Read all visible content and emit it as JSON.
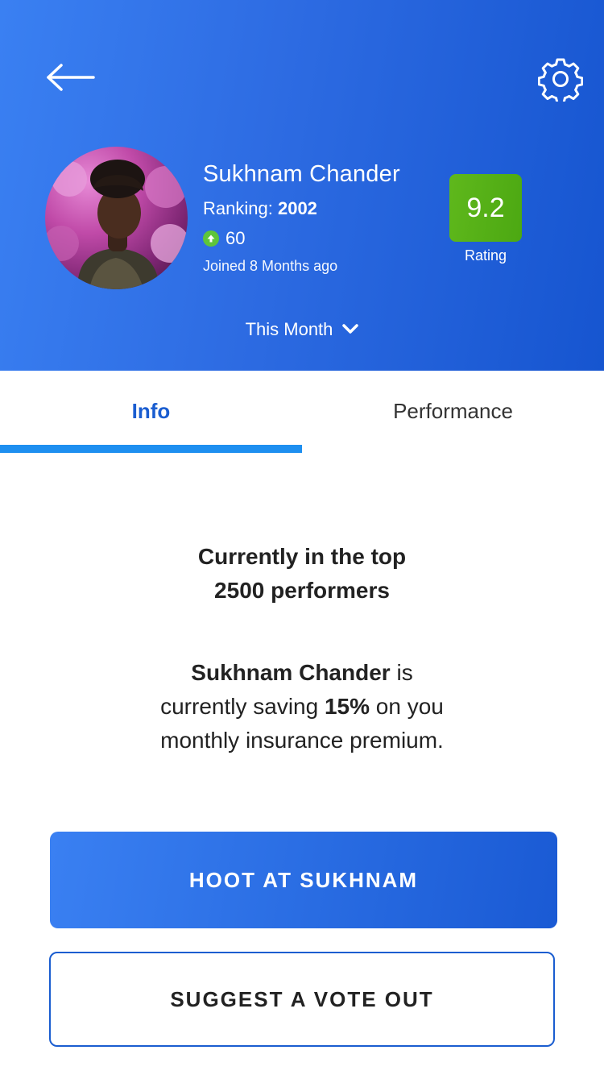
{
  "header": {
    "back_icon": "arrow-left-icon",
    "settings_icon": "gear-icon",
    "profile": {
      "name": "Sukhnam Chander",
      "ranking_label": "Ranking:",
      "ranking_value": "2002",
      "points": "60",
      "points_icon": "arrow-up-circle-icon",
      "joined": "Joined 8 Months ago"
    },
    "rating": {
      "value": "9.2",
      "label": "Rating"
    },
    "period": {
      "label": "This Month",
      "icon": "chevron-down-icon"
    }
  },
  "tabs": [
    {
      "label": "Info",
      "active": true
    },
    {
      "label": "Performance",
      "active": false
    }
  ],
  "info": {
    "top_line1": "Currently in the top",
    "top_line2": "2500 performers",
    "saving_name": "Sukhnam Chander",
    "saving_is": " is",
    "saving_line2_pre": "currently saving ",
    "saving_percent": "15%",
    "saving_line2_post": " on you",
    "saving_line3": "monthly insurance premium."
  },
  "actions": {
    "primary_label": "HOOT AT SUKHNAM",
    "secondary_label": "SUGGEST A VOTE OUT"
  },
  "colors": {
    "header_start": "#3a80f2",
    "header_end": "#1655d0",
    "rating_green": "#5fb81c",
    "points_green": "#5ec53a",
    "tab_active": "#1a5dd0",
    "tab_indicator": "#1e8ff0"
  }
}
